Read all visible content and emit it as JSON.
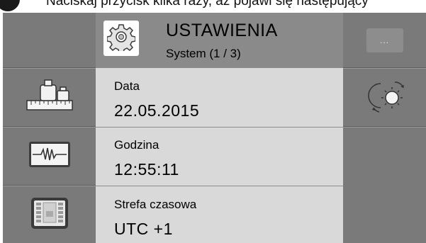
{
  "instruction_text": "Naciskaj przycisk kilka razy, aż pojawi się następujący",
  "header": {
    "title": "USTAWIENIA",
    "subtitle": "System (1 / 3)"
  },
  "rows": [
    {
      "label": "Data",
      "value": "22.05.2015"
    },
    {
      "label": "Godzina",
      "value": "12:55:11"
    },
    {
      "label": "Strefa czasowa",
      "value": "UTC +1"
    }
  ],
  "right": {
    "more_label": "..."
  },
  "icons": {
    "header": "gear-icon",
    "left": [
      "weights-ruler-icon",
      "waveform-icon",
      "display-icon"
    ],
    "right": [
      "day-night-icon"
    ]
  },
  "colors": {
    "side_columns": "#7a7a7a",
    "header_bg": "#8a8a8a",
    "content_bg": "#d9d9d9"
  }
}
